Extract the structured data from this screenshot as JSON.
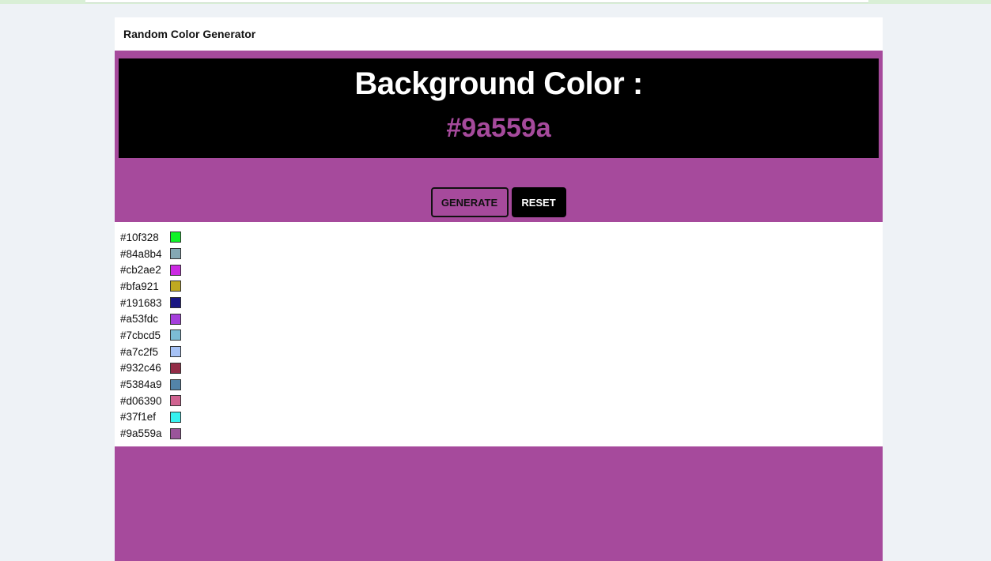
{
  "app": {
    "title": "Random Color Generator"
  },
  "hero": {
    "title": "Background Color :",
    "current_hex": "#9a559a",
    "accent_color": "#a64a9c"
  },
  "buttons": {
    "generate_label": "GENERATE",
    "reset_label": "RESET"
  },
  "history": [
    {
      "hex": "#10f328"
    },
    {
      "hex": "#84a8b4"
    },
    {
      "hex": "#cb2ae2"
    },
    {
      "hex": "#bfa921"
    },
    {
      "hex": "#191683"
    },
    {
      "hex": "#a53fdc"
    },
    {
      "hex": "#7cbcd5"
    },
    {
      "hex": "#a7c2f5"
    },
    {
      "hex": "#932c46"
    },
    {
      "hex": "#5384a9"
    },
    {
      "hex": "#d06390"
    },
    {
      "hex": "#37f1ef"
    },
    {
      "hex": "#9a559a"
    }
  ]
}
